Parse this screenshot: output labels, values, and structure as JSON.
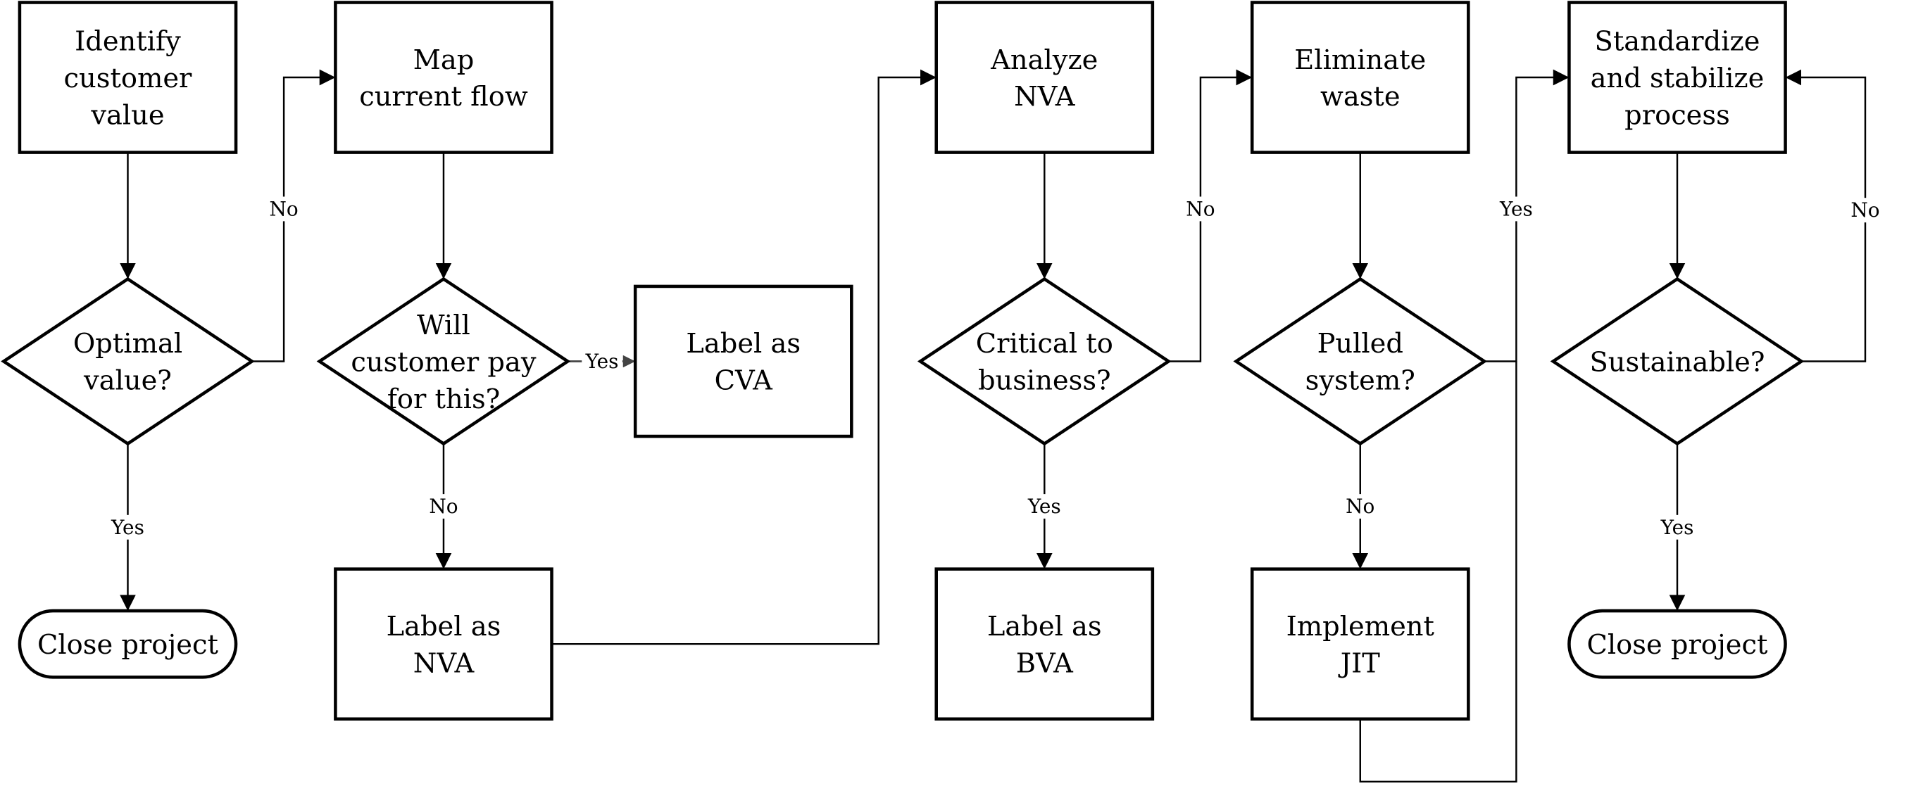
{
  "diagram": {
    "type": "flowchart",
    "nodes": [
      {
        "id": "identify",
        "shape": "process",
        "lines": [
          "Identify",
          "customer",
          "value"
        ]
      },
      {
        "id": "optimal",
        "shape": "decision",
        "lines": [
          "Optimal",
          "value?"
        ]
      },
      {
        "id": "close1",
        "shape": "terminal",
        "lines": [
          "Close project"
        ]
      },
      {
        "id": "map",
        "shape": "process",
        "lines": [
          "Map",
          "current flow"
        ]
      },
      {
        "id": "willpay",
        "shape": "decision",
        "lines": [
          "Will",
          "customer pay",
          "for this?"
        ]
      },
      {
        "id": "cva",
        "shape": "process",
        "lines": [
          "Label as",
          "CVA"
        ]
      },
      {
        "id": "nva",
        "shape": "process",
        "lines": [
          "Label as",
          "NVA"
        ]
      },
      {
        "id": "analyze",
        "shape": "process",
        "lines": [
          "Analyze",
          "NVA"
        ]
      },
      {
        "id": "critical",
        "shape": "decision",
        "lines": [
          "Critical to",
          "business?"
        ]
      },
      {
        "id": "bva",
        "shape": "process",
        "lines": [
          "Label as",
          "BVA"
        ]
      },
      {
        "id": "eliminate",
        "shape": "process",
        "lines": [
          "Eliminate",
          "waste"
        ]
      },
      {
        "id": "pulled",
        "shape": "decision",
        "lines": [
          "Pulled",
          "system?"
        ]
      },
      {
        "id": "jit",
        "shape": "process",
        "lines": [
          "Implement",
          "JIT"
        ]
      },
      {
        "id": "standardize",
        "shape": "process",
        "lines": [
          "Standardize",
          "and stabilize",
          "process"
        ]
      },
      {
        "id": "sustainable",
        "shape": "decision",
        "lines": [
          "Sustainable?"
        ]
      },
      {
        "id": "close2",
        "shape": "terminal",
        "lines": [
          "Close project"
        ]
      }
    ],
    "edges": [
      {
        "from": "identify",
        "to": "optimal",
        "label": ""
      },
      {
        "from": "optimal",
        "to": "close1",
        "label": "Yes"
      },
      {
        "from": "optimal",
        "to": "map",
        "label": "No"
      },
      {
        "from": "map",
        "to": "willpay",
        "label": ""
      },
      {
        "from": "willpay",
        "to": "cva",
        "label": "Yes"
      },
      {
        "from": "willpay",
        "to": "nva",
        "label": "No"
      },
      {
        "from": "nva",
        "to": "analyze",
        "label": ""
      },
      {
        "from": "analyze",
        "to": "critical",
        "label": ""
      },
      {
        "from": "critical",
        "to": "bva",
        "label": "Yes"
      },
      {
        "from": "critical",
        "to": "eliminate",
        "label": "No"
      },
      {
        "from": "eliminate",
        "to": "pulled",
        "label": ""
      },
      {
        "from": "pulled",
        "to": "jit",
        "label": "No"
      },
      {
        "from": "pulled",
        "to": "standardize",
        "label": "Yes"
      },
      {
        "from": "jit",
        "to": "standardize",
        "label": ""
      },
      {
        "from": "standardize",
        "to": "sustainable",
        "label": ""
      },
      {
        "from": "sustainable",
        "to": "close2",
        "label": "Yes"
      },
      {
        "from": "sustainable",
        "to": "standardize",
        "label": "No"
      }
    ],
    "colors": {
      "stroke": "#000000",
      "yes_cva_edge": "#444444",
      "background": "#ffffff"
    }
  }
}
